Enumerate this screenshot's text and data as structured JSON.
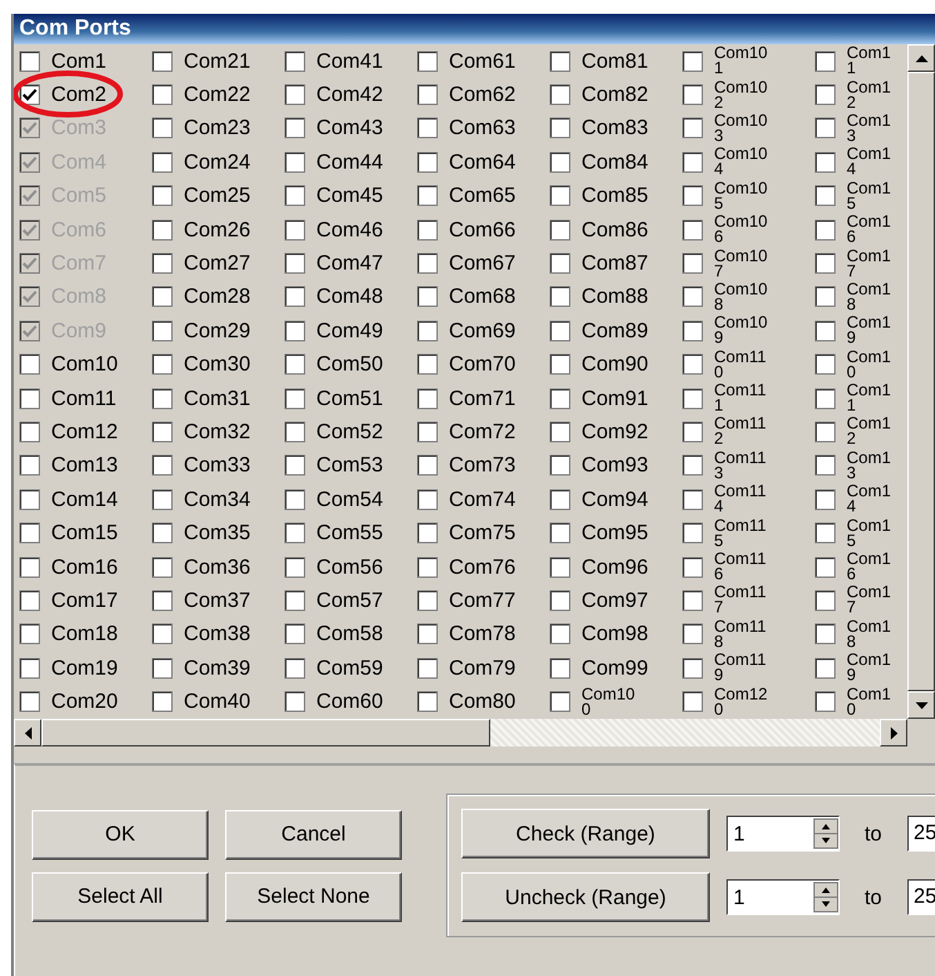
{
  "window": {
    "title": "Com Ports"
  },
  "columns": [
    {
      "items": [
        {
          "label": "Com1",
          "checked": false,
          "disabled": false,
          "circled": false
        },
        {
          "label": "Com2",
          "checked": true,
          "disabled": false,
          "circled": true
        },
        {
          "label": "Com3",
          "checked": true,
          "disabled": true,
          "circled": false
        },
        {
          "label": "Com4",
          "checked": true,
          "disabled": true,
          "circled": false
        },
        {
          "label": "Com5",
          "checked": true,
          "disabled": true,
          "circled": false
        },
        {
          "label": "Com6",
          "checked": true,
          "disabled": true,
          "circled": false
        },
        {
          "label": "Com7",
          "checked": true,
          "disabled": true,
          "circled": false
        },
        {
          "label": "Com8",
          "checked": true,
          "disabled": true,
          "circled": false
        },
        {
          "label": "Com9",
          "checked": true,
          "disabled": true,
          "circled": false
        },
        {
          "label": "Com10",
          "checked": false,
          "disabled": false,
          "circled": false
        },
        {
          "label": "Com11",
          "checked": false,
          "disabled": false,
          "circled": false
        },
        {
          "label": "Com12",
          "checked": false,
          "disabled": false,
          "circled": false
        },
        {
          "label": "Com13",
          "checked": false,
          "disabled": false,
          "circled": false
        },
        {
          "label": "Com14",
          "checked": false,
          "disabled": false,
          "circled": false
        },
        {
          "label": "Com15",
          "checked": false,
          "disabled": false,
          "circled": false
        },
        {
          "label": "Com16",
          "checked": false,
          "disabled": false,
          "circled": false
        },
        {
          "label": "Com17",
          "checked": false,
          "disabled": false,
          "circled": false
        },
        {
          "label": "Com18",
          "checked": false,
          "disabled": false,
          "circled": false
        },
        {
          "label": "Com19",
          "checked": false,
          "disabled": false,
          "circled": false
        },
        {
          "label": "Com20",
          "checked": false,
          "disabled": false,
          "circled": false
        }
      ]
    },
    {
      "items": [
        {
          "label": "Com21",
          "checked": false,
          "disabled": false,
          "circled": false
        },
        {
          "label": "Com22",
          "checked": false,
          "disabled": false,
          "circled": false
        },
        {
          "label": "Com23",
          "checked": false,
          "disabled": false,
          "circled": false
        },
        {
          "label": "Com24",
          "checked": false,
          "disabled": false,
          "circled": false
        },
        {
          "label": "Com25",
          "checked": false,
          "disabled": false,
          "circled": false
        },
        {
          "label": "Com26",
          "checked": false,
          "disabled": false,
          "circled": false
        },
        {
          "label": "Com27",
          "checked": false,
          "disabled": false,
          "circled": false
        },
        {
          "label": "Com28",
          "checked": false,
          "disabled": false,
          "circled": false
        },
        {
          "label": "Com29",
          "checked": false,
          "disabled": false,
          "circled": false
        },
        {
          "label": "Com30",
          "checked": false,
          "disabled": false,
          "circled": false
        },
        {
          "label": "Com31",
          "checked": false,
          "disabled": false,
          "circled": false
        },
        {
          "label": "Com32",
          "checked": false,
          "disabled": false,
          "circled": false
        },
        {
          "label": "Com33",
          "checked": false,
          "disabled": false,
          "circled": false
        },
        {
          "label": "Com34",
          "checked": false,
          "disabled": false,
          "circled": false
        },
        {
          "label": "Com35",
          "checked": false,
          "disabled": false,
          "circled": false
        },
        {
          "label": "Com36",
          "checked": false,
          "disabled": false,
          "circled": false
        },
        {
          "label": "Com37",
          "checked": false,
          "disabled": false,
          "circled": false
        },
        {
          "label": "Com38",
          "checked": false,
          "disabled": false,
          "circled": false
        },
        {
          "label": "Com39",
          "checked": false,
          "disabled": false,
          "circled": false
        },
        {
          "label": "Com40",
          "checked": false,
          "disabled": false,
          "circled": false
        }
      ]
    },
    {
      "items": [
        {
          "label": "Com41",
          "checked": false,
          "disabled": false,
          "circled": false
        },
        {
          "label": "Com42",
          "checked": false,
          "disabled": false,
          "circled": false
        },
        {
          "label": "Com43",
          "checked": false,
          "disabled": false,
          "circled": false
        },
        {
          "label": "Com44",
          "checked": false,
          "disabled": false,
          "circled": false
        },
        {
          "label": "Com45",
          "checked": false,
          "disabled": false,
          "circled": false
        },
        {
          "label": "Com46",
          "checked": false,
          "disabled": false,
          "circled": false
        },
        {
          "label": "Com47",
          "checked": false,
          "disabled": false,
          "circled": false
        },
        {
          "label": "Com48",
          "checked": false,
          "disabled": false,
          "circled": false
        },
        {
          "label": "Com49",
          "checked": false,
          "disabled": false,
          "circled": false
        },
        {
          "label": "Com50",
          "checked": false,
          "disabled": false,
          "circled": false
        },
        {
          "label": "Com51",
          "checked": false,
          "disabled": false,
          "circled": false
        },
        {
          "label": "Com52",
          "checked": false,
          "disabled": false,
          "circled": false
        },
        {
          "label": "Com53",
          "checked": false,
          "disabled": false,
          "circled": false
        },
        {
          "label": "Com54",
          "checked": false,
          "disabled": false,
          "circled": false
        },
        {
          "label": "Com55",
          "checked": false,
          "disabled": false,
          "circled": false
        },
        {
          "label": "Com56",
          "checked": false,
          "disabled": false,
          "circled": false
        },
        {
          "label": "Com57",
          "checked": false,
          "disabled": false,
          "circled": false
        },
        {
          "label": "Com58",
          "checked": false,
          "disabled": false,
          "circled": false
        },
        {
          "label": "Com59",
          "checked": false,
          "disabled": false,
          "circled": false
        },
        {
          "label": "Com60",
          "checked": false,
          "disabled": false,
          "circled": false
        }
      ]
    },
    {
      "items": [
        {
          "label": "Com61",
          "checked": false,
          "disabled": false,
          "circled": false
        },
        {
          "label": "Com62",
          "checked": false,
          "disabled": false,
          "circled": false
        },
        {
          "label": "Com63",
          "checked": false,
          "disabled": false,
          "circled": false
        },
        {
          "label": "Com64",
          "checked": false,
          "disabled": false,
          "circled": false
        },
        {
          "label": "Com65",
          "checked": false,
          "disabled": false,
          "circled": false
        },
        {
          "label": "Com66",
          "checked": false,
          "disabled": false,
          "circled": false
        },
        {
          "label": "Com67",
          "checked": false,
          "disabled": false,
          "circled": false
        },
        {
          "label": "Com68",
          "checked": false,
          "disabled": false,
          "circled": false
        },
        {
          "label": "Com69",
          "checked": false,
          "disabled": false,
          "circled": false
        },
        {
          "label": "Com70",
          "checked": false,
          "disabled": false,
          "circled": false
        },
        {
          "label": "Com71",
          "checked": false,
          "disabled": false,
          "circled": false
        },
        {
          "label": "Com72",
          "checked": false,
          "disabled": false,
          "circled": false
        },
        {
          "label": "Com73",
          "checked": false,
          "disabled": false,
          "circled": false
        },
        {
          "label": "Com74",
          "checked": false,
          "disabled": false,
          "circled": false
        },
        {
          "label": "Com75",
          "checked": false,
          "disabled": false,
          "circled": false
        },
        {
          "label": "Com76",
          "checked": false,
          "disabled": false,
          "circled": false
        },
        {
          "label": "Com77",
          "checked": false,
          "disabled": false,
          "circled": false
        },
        {
          "label": "Com78",
          "checked": false,
          "disabled": false,
          "circled": false
        },
        {
          "label": "Com79",
          "checked": false,
          "disabled": false,
          "circled": false
        },
        {
          "label": "Com80",
          "checked": false,
          "disabled": false,
          "circled": false
        }
      ]
    },
    {
      "items": [
        {
          "label": "Com81",
          "checked": false,
          "disabled": false,
          "circled": false
        },
        {
          "label": "Com82",
          "checked": false,
          "disabled": false,
          "circled": false
        },
        {
          "label": "Com83",
          "checked": false,
          "disabled": false,
          "circled": false
        },
        {
          "label": "Com84",
          "checked": false,
          "disabled": false,
          "circled": false
        },
        {
          "label": "Com85",
          "checked": false,
          "disabled": false,
          "circled": false
        },
        {
          "label": "Com86",
          "checked": false,
          "disabled": false,
          "circled": false
        },
        {
          "label": "Com87",
          "checked": false,
          "disabled": false,
          "circled": false
        },
        {
          "label": "Com88",
          "checked": false,
          "disabled": false,
          "circled": false
        },
        {
          "label": "Com89",
          "checked": false,
          "disabled": false,
          "circled": false
        },
        {
          "label": "Com90",
          "checked": false,
          "disabled": false,
          "circled": false
        },
        {
          "label": "Com91",
          "checked": false,
          "disabled": false,
          "circled": false
        },
        {
          "label": "Com92",
          "checked": false,
          "disabled": false,
          "circled": false
        },
        {
          "label": "Com93",
          "checked": false,
          "disabled": false,
          "circled": false
        },
        {
          "label": "Com94",
          "checked": false,
          "disabled": false,
          "circled": false
        },
        {
          "label": "Com95",
          "checked": false,
          "disabled": false,
          "circled": false
        },
        {
          "label": "Com96",
          "checked": false,
          "disabled": false,
          "circled": false
        },
        {
          "label": "Com97",
          "checked": false,
          "disabled": false,
          "circled": false
        },
        {
          "label": "Com98",
          "checked": false,
          "disabled": false,
          "circled": false
        },
        {
          "label": "Com99",
          "checked": false,
          "disabled": false,
          "circled": false
        },
        {
          "lines": [
            "Com10",
            "0"
          ],
          "checked": false,
          "disabled": false,
          "circled": false
        }
      ]
    },
    {
      "items": [
        {
          "lines": [
            "Com10",
            "1"
          ],
          "checked": false,
          "disabled": false,
          "circled": false
        },
        {
          "lines": [
            "Com10",
            "2"
          ],
          "checked": false,
          "disabled": false,
          "circled": false
        },
        {
          "lines": [
            "Com10",
            "3"
          ],
          "checked": false,
          "disabled": false,
          "circled": false
        },
        {
          "lines": [
            "Com10",
            "4"
          ],
          "checked": false,
          "disabled": false,
          "circled": false
        },
        {
          "lines": [
            "Com10",
            "5"
          ],
          "checked": false,
          "disabled": false,
          "circled": false
        },
        {
          "lines": [
            "Com10",
            "6"
          ],
          "checked": false,
          "disabled": false,
          "circled": false
        },
        {
          "lines": [
            "Com10",
            "7"
          ],
          "checked": false,
          "disabled": false,
          "circled": false
        },
        {
          "lines": [
            "Com10",
            "8"
          ],
          "checked": false,
          "disabled": false,
          "circled": false
        },
        {
          "lines": [
            "Com10",
            "9"
          ],
          "checked": false,
          "disabled": false,
          "circled": false
        },
        {
          "lines": [
            "Com11",
            "0"
          ],
          "checked": false,
          "disabled": false,
          "circled": false
        },
        {
          "lines": [
            "Com11",
            "1"
          ],
          "checked": false,
          "disabled": false,
          "circled": false
        },
        {
          "lines": [
            "Com11",
            "2"
          ],
          "checked": false,
          "disabled": false,
          "circled": false
        },
        {
          "lines": [
            "Com11",
            "3"
          ],
          "checked": false,
          "disabled": false,
          "circled": false
        },
        {
          "lines": [
            "Com11",
            "4"
          ],
          "checked": false,
          "disabled": false,
          "circled": false
        },
        {
          "lines": [
            "Com11",
            "5"
          ],
          "checked": false,
          "disabled": false,
          "circled": false
        },
        {
          "lines": [
            "Com11",
            "6"
          ],
          "checked": false,
          "disabled": false,
          "circled": false
        },
        {
          "lines": [
            "Com11",
            "7"
          ],
          "checked": false,
          "disabled": false,
          "circled": false
        },
        {
          "lines": [
            "Com11",
            "8"
          ],
          "checked": false,
          "disabled": false,
          "circled": false
        },
        {
          "lines": [
            "Com11",
            "9"
          ],
          "checked": false,
          "disabled": false,
          "circled": false
        },
        {
          "lines": [
            "Com12",
            "0"
          ],
          "checked": false,
          "disabled": false,
          "circled": false
        }
      ]
    },
    {
      "items": [
        {
          "lines": [
            "Com1",
            "1"
          ],
          "checked": false,
          "disabled": false,
          "circled": false
        },
        {
          "lines": [
            "Com1",
            "2"
          ],
          "checked": false,
          "disabled": false,
          "circled": false
        },
        {
          "lines": [
            "Com1",
            "3"
          ],
          "checked": false,
          "disabled": false,
          "circled": false
        },
        {
          "lines": [
            "Com1",
            "4"
          ],
          "checked": false,
          "disabled": false,
          "circled": false
        },
        {
          "lines": [
            "Com1",
            "5"
          ],
          "checked": false,
          "disabled": false,
          "circled": false
        },
        {
          "lines": [
            "Com1",
            "6"
          ],
          "checked": false,
          "disabled": false,
          "circled": false
        },
        {
          "lines": [
            "Com1",
            "7"
          ],
          "checked": false,
          "disabled": false,
          "circled": false
        },
        {
          "lines": [
            "Com1",
            "8"
          ],
          "checked": false,
          "disabled": false,
          "circled": false
        },
        {
          "lines": [
            "Com1",
            "9"
          ],
          "checked": false,
          "disabled": false,
          "circled": false
        },
        {
          "lines": [
            "Com1",
            "0"
          ],
          "checked": false,
          "disabled": false,
          "circled": false
        },
        {
          "lines": [
            "Com1",
            "1"
          ],
          "checked": false,
          "disabled": false,
          "circled": false
        },
        {
          "lines": [
            "Com1",
            "2"
          ],
          "checked": false,
          "disabled": false,
          "circled": false
        },
        {
          "lines": [
            "Com1",
            "3"
          ],
          "checked": false,
          "disabled": false,
          "circled": false
        },
        {
          "lines": [
            "Com1",
            "4"
          ],
          "checked": false,
          "disabled": false,
          "circled": false
        },
        {
          "lines": [
            "Com1",
            "5"
          ],
          "checked": false,
          "disabled": false,
          "circled": false
        },
        {
          "lines": [
            "Com1",
            "6"
          ],
          "checked": false,
          "disabled": false,
          "circled": false
        },
        {
          "lines": [
            "Com1",
            "7"
          ],
          "checked": false,
          "disabled": false,
          "circled": false
        },
        {
          "lines": [
            "Com1",
            "8"
          ],
          "checked": false,
          "disabled": false,
          "circled": false
        },
        {
          "lines": [
            "Com1",
            "9"
          ],
          "checked": false,
          "disabled": false,
          "circled": false
        },
        {
          "lines": [
            "Com1",
            "0"
          ],
          "checked": false,
          "disabled": false,
          "circled": false
        }
      ]
    }
  ],
  "buttons": [
    {
      "label": "OK"
    },
    {
      "label": "Cancel"
    },
    {
      "label": "Select All"
    },
    {
      "label": "Select None"
    }
  ],
  "range_rows": [
    {
      "button": "Check (Range)",
      "from": "1",
      "to_label": "to",
      "to": "25"
    },
    {
      "button": "Uncheck (Range)",
      "from": "1",
      "to_label": "to",
      "to": "25"
    }
  ]
}
